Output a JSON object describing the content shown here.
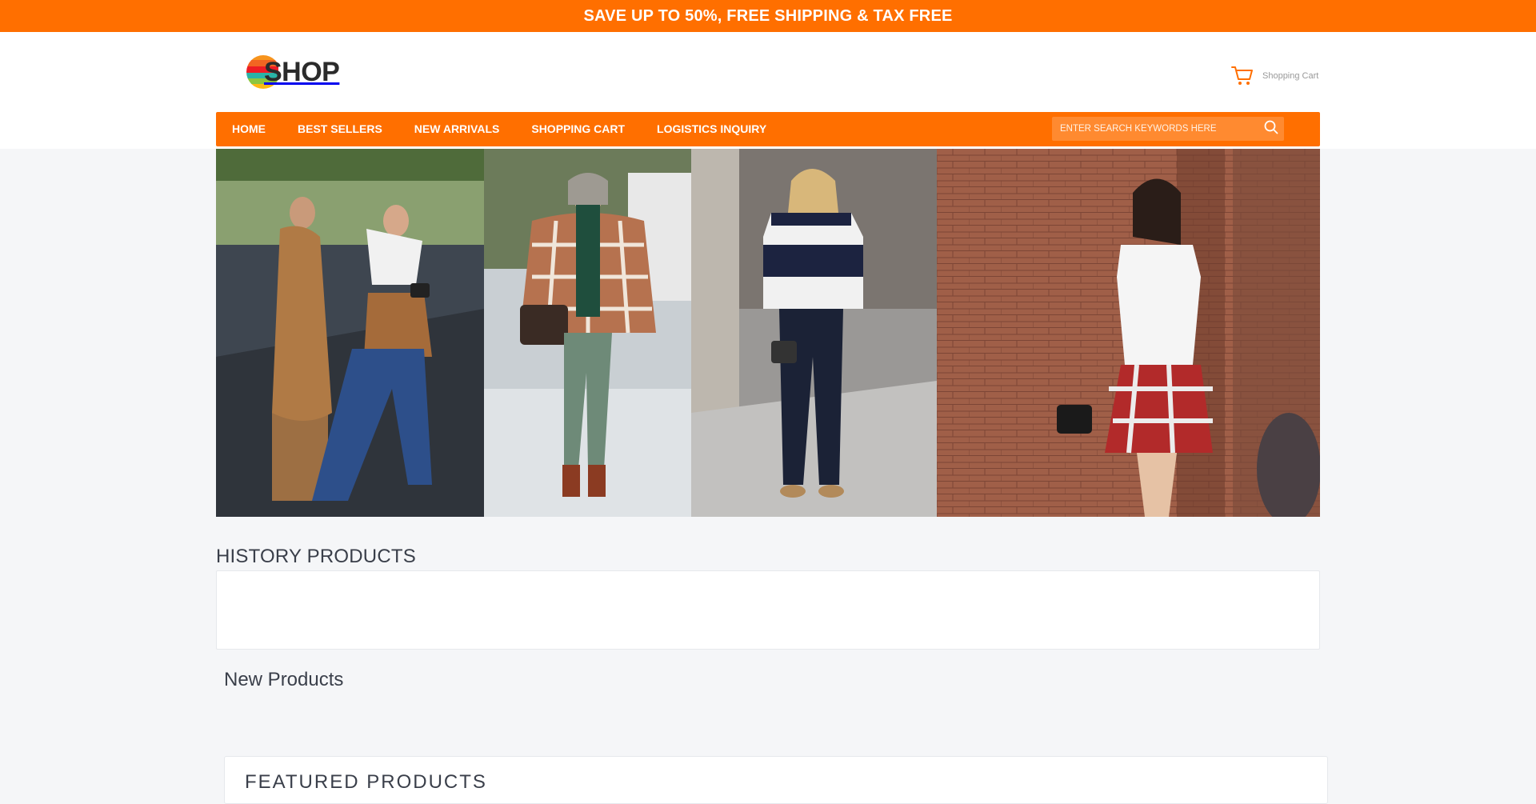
{
  "promo": {
    "text": "SAVE UP TO 50%, FREE SHIPPING & TAX FREE"
  },
  "logo": {
    "text": "SHOP"
  },
  "cart": {
    "label": "Shopping Cart"
  },
  "nav": {
    "items": [
      {
        "label": "HOME"
      },
      {
        "label": "BEST SELLERS"
      },
      {
        "label": "NEW ARRIVALS"
      },
      {
        "label": "SHOPPING CART"
      },
      {
        "label": "LOGISTICS INQUIRY"
      }
    ]
  },
  "search": {
    "placeholder": "ENTER SEARCH KEYWORDS HERE"
  },
  "sections": {
    "history_title": "HISTORY PRODUCTS",
    "new_title": "New Products",
    "featured_title": "FEATURED PRODUCTS"
  },
  "colors": {
    "brand_orange": "#ff6f00",
    "background": "#f5f6f8",
    "text_dark": "#3a3f4a"
  },
  "icons": {
    "cart": "shopping-cart-icon",
    "search": "search-icon"
  }
}
